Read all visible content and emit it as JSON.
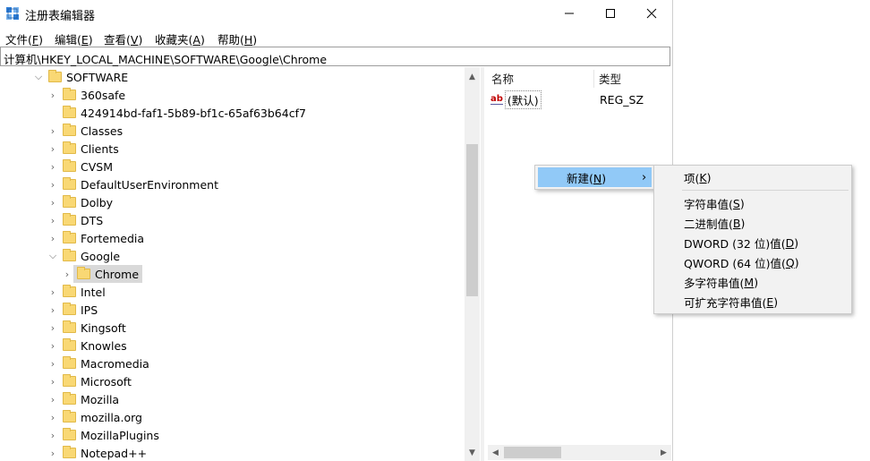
{
  "window": {
    "title": "注册表编辑器",
    "minimize_glyph": "—",
    "maximize_glyph": "☐",
    "close_glyph": "✕"
  },
  "menu": [
    {
      "label": "文件(",
      "key": "F",
      "end": ")"
    },
    {
      "label": "编辑(",
      "key": "E",
      "end": ")"
    },
    {
      "label": "查看(",
      "key": "V",
      "end": ")"
    },
    {
      "label": "收藏夹(",
      "key": "A",
      "end": ")"
    },
    {
      "label": "帮助(",
      "key": "H",
      "end": ")"
    }
  ],
  "address": "计算机\\HKEY_LOCAL_MACHINE\\SOFTWARE\\Google\\Chrome",
  "tree": {
    "root": "SOFTWARE",
    "children": [
      "360safe",
      "424914bd-faf1-5b89-bf1c-65af63b64cf7",
      "Classes",
      "Clients",
      "CVSM",
      "DefaultUserEnvironment",
      "Dolby",
      "DTS",
      "Fortemedia",
      "Google"
    ],
    "google_child": "Chrome",
    "after": [
      "Intel",
      "IPS",
      "Kingsoft",
      "Knowles",
      "Macromedia",
      "Microsoft",
      "Mozilla",
      "mozilla.org",
      "MozillaPlugins",
      "Notepad++"
    ]
  },
  "list": {
    "col_name": "名称",
    "col_type": "类型",
    "rows": [
      {
        "icon": "ab",
        "name": "(默认)",
        "type": "REG_SZ"
      }
    ]
  },
  "context_menu": {
    "new_label": "新建(",
    "new_key": "N",
    "new_end": ")",
    "submenu_arrow": "›"
  },
  "submenu": [
    {
      "label": "项(",
      "key": "K",
      "end": ")"
    },
    {
      "label": "字符串值(",
      "key": "S",
      "end": ")"
    },
    {
      "label": "二进制值(",
      "key": "B",
      "end": ")"
    },
    {
      "label": "DWORD (32 位)值(",
      "key": "D",
      "end": ")"
    },
    {
      "label": "QWORD (64 位)值(",
      "key": "Q",
      "end": ")"
    },
    {
      "label": "多字符串值(",
      "key": "M",
      "end": ")"
    },
    {
      "label": "可扩充字符串值(",
      "key": "E",
      "end": ")"
    }
  ],
  "colors": {
    "folder": "#f9d874",
    "highlight": "#91c9f7",
    "selection": "#d9d9d9"
  }
}
